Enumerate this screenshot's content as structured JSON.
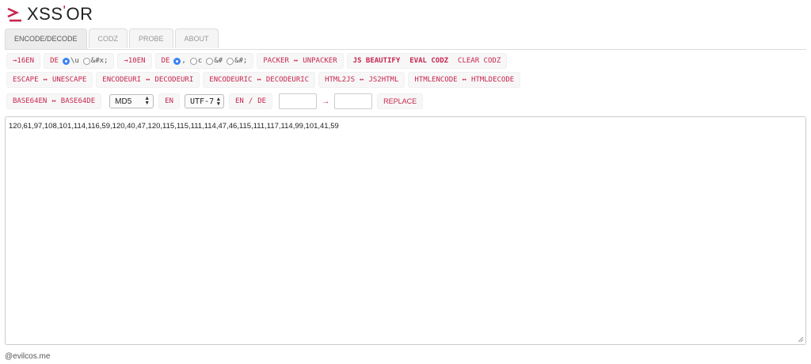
{
  "header": {
    "title_main": "XSS",
    "title_apos": "'",
    "title_end": "OR",
    "logo_icon": "prompt-underscore-icon"
  },
  "tabs": [
    {
      "label": "ENCODE/DECODE",
      "active": true
    },
    {
      "label": "CODZ",
      "active": false
    },
    {
      "label": "PROBE",
      "active": false
    },
    {
      "label": "ABOUT",
      "active": false
    }
  ],
  "row1": {
    "to16en": "→16EN",
    "de16": "DE",
    "radio_u": "\\u",
    "radio_hex": "&#x;",
    "to10en": "→10EN",
    "de10": "DE",
    "radio_comma": ",",
    "radio_c": "c",
    "radio_amp": "&#",
    "radio_ampsemi": "&#;",
    "packer": "PACKER",
    "arrow": "↔",
    "unpacker": "UNPACKER",
    "js_beautify": "JS BEAUTIFY",
    "eval_codz": "EVAL CODZ",
    "clear_codz": "CLEAR CODZ"
  },
  "row2": {
    "escape": "ESCAPE",
    "unescape": "UNESCAPE",
    "encodeuri": "ENCODEURI",
    "decodeuri": "DECODEURI",
    "encodeuric": "ENCODEURIC",
    "decodeuric": "DECODEURIC",
    "html2js": "HTML2JS",
    "js2html": "JS2HTML",
    "htmlencode": "HTMLENCODE",
    "htmldecode": "HTMLDECODE",
    "arrow": "↔"
  },
  "row3": {
    "base64en": "BASE64EN",
    "base64de": "BASE64DE",
    "arrow": "↔",
    "hash_select": "MD5",
    "en": "EN",
    "charset_select": "UTF-7",
    "en2": "EN",
    "slash": "/",
    "de2": "DE",
    "replace_from": "",
    "replace_arrow": "→",
    "replace_to": "",
    "replace": "REPLACE"
  },
  "main": {
    "content": "120,61,97,108,101,114,116,59,120,40,47,120,115,115,111,114,47,46,115,111,117,114,99,101,41,59"
  },
  "footer": {
    "text": "@evilcos.me"
  },
  "colors": {
    "accent": "#c7254e",
    "radio": "#3b82f6"
  }
}
